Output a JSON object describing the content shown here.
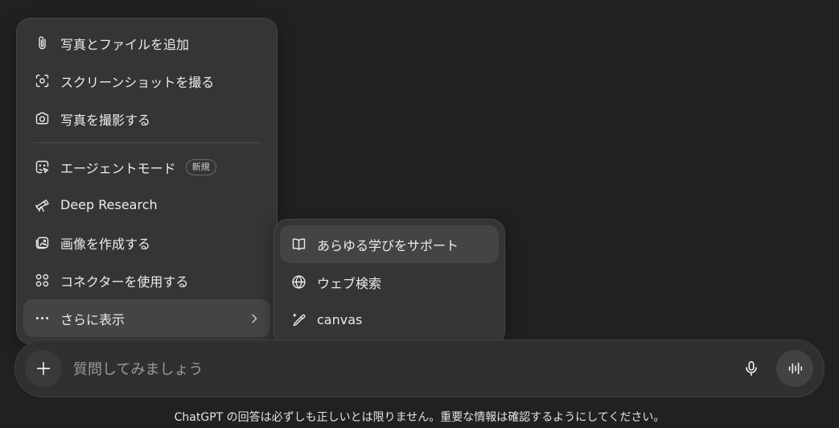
{
  "attach_menu": {
    "items": [
      {
        "label": "写真とファイルを追加",
        "icon": "paperclip-icon"
      },
      {
        "label": "スクリーンショットを撮る",
        "icon": "screenshot-icon"
      },
      {
        "label": "写真を撮影する",
        "icon": "camera-icon"
      },
      {
        "label": "エージェントモード",
        "icon": "agent-icon",
        "badge": "新規"
      },
      {
        "label": "Deep Research",
        "icon": "telescope-icon"
      },
      {
        "label": "画像を作成する",
        "icon": "image-create-icon"
      },
      {
        "label": "コネクターを使用する",
        "icon": "connectors-icon"
      },
      {
        "label": "さらに表示",
        "icon": "more-dots-icon"
      }
    ]
  },
  "more_menu": {
    "items": [
      {
        "label": "あらゆる学びをサポート",
        "icon": "book-open-icon"
      },
      {
        "label": "ウェブ検索",
        "icon": "globe-icon"
      },
      {
        "label": "canvas",
        "icon": "pen-sparkle-icon"
      }
    ]
  },
  "composer": {
    "placeholder": "質問してみましょう"
  },
  "footer": {
    "disclaimer": "ChatGPT の回答は必ずしも正しいとは限りません。重要な情報は確認するようにしてください。"
  },
  "colors": {
    "background": "#212121",
    "menu": "#353535",
    "hover": "#444444",
    "composer": "#303030",
    "text": "#ececec"
  }
}
